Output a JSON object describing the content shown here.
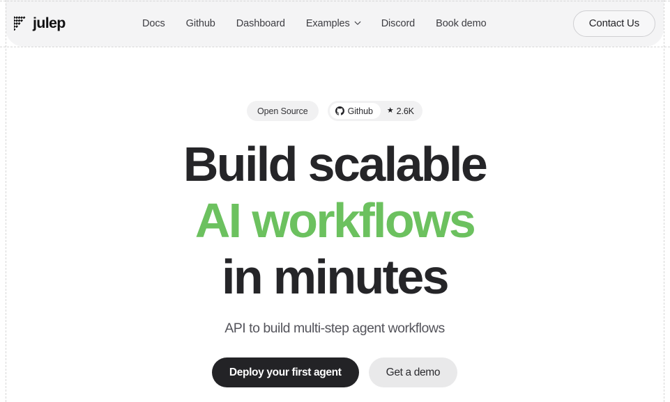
{
  "brand": {
    "name": "julep",
    "logo_icon": "julep-diagonal-stripes-mark"
  },
  "nav": {
    "items": [
      {
        "label": "Docs",
        "has_dropdown": false
      },
      {
        "label": "Github",
        "has_dropdown": false
      },
      {
        "label": "Dashboard",
        "has_dropdown": false
      },
      {
        "label": "Examples",
        "has_dropdown": true
      },
      {
        "label": "Discord",
        "has_dropdown": false
      },
      {
        "label": "Book demo",
        "has_dropdown": false
      }
    ],
    "contact_label": "Contact Us",
    "dropdown_icon": "chevron-down-icon"
  },
  "hero": {
    "badges": {
      "open_source_label": "Open Source",
      "github_label": "Github",
      "github_icon": "github-icon",
      "star_icon": "star-icon",
      "star_count": "2.6K"
    },
    "headline_lines": [
      {
        "text": "Build scalable",
        "accent": false
      },
      {
        "text": "AI workflows",
        "accent": true
      },
      {
        "text": "in minutes",
        "accent": false
      }
    ],
    "subtitle": "API to build multi-step agent workflows",
    "cta_primary": "Deploy your first agent",
    "cta_secondary": "Get a demo"
  },
  "colors": {
    "accent_green": "#6cc15f",
    "ink": "#252528",
    "header_bg": "#f4f4f5",
    "pill_bg": "#f1f1f2",
    "primary_button_bg": "#232326",
    "secondary_button_bg": "#e9e9ea",
    "guide_line": "#d6d6d6"
  }
}
